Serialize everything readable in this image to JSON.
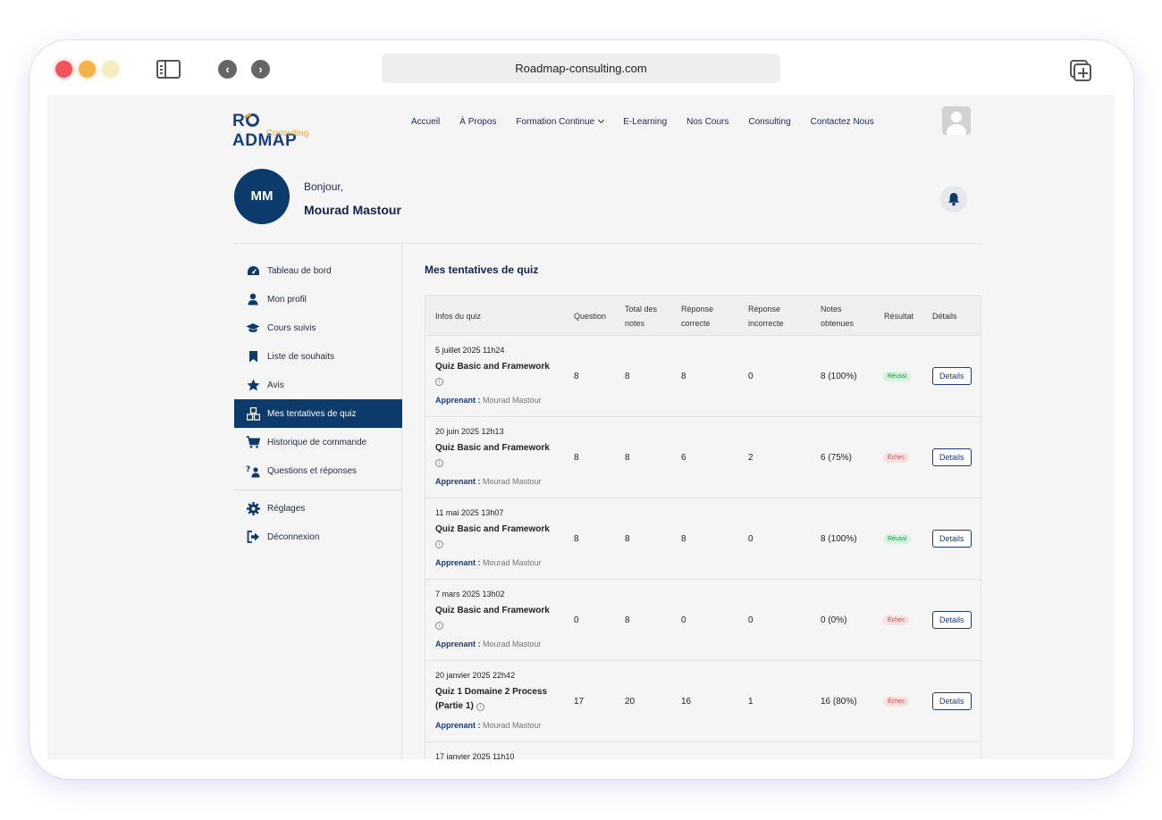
{
  "browser": {
    "url": "Roadmap-consulting.com"
  },
  "site": {
    "logo_main": "ROADMAP",
    "logo_sub": "Consulting",
    "nav": [
      "Accueil",
      "À Propos",
      "Formation Continue",
      "E-Learning",
      "Nos Cours",
      "Consulting",
      "Contactez Nous"
    ]
  },
  "profile": {
    "initials": "MM",
    "greeting": "Bonjour,",
    "name": "Mourad Mastour"
  },
  "menu": {
    "items": [
      {
        "label": "Tableau de bord",
        "icon": "dashboard-icon"
      },
      {
        "label": "Mon profil",
        "icon": "user-icon"
      },
      {
        "label": "Cours suivis",
        "icon": "graduation-cap-icon"
      },
      {
        "label": "Liste de souhaits",
        "icon": "bookmark-icon"
      },
      {
        "label": "Avis",
        "icon": "star-icon"
      },
      {
        "label": "Mes tentatives de quiz",
        "icon": "quiz-blocks-icon",
        "active": true
      },
      {
        "label": "Historique de commande",
        "icon": "cart-icon"
      },
      {
        "label": "Questions et réponses",
        "icon": "question-answer-icon"
      }
    ],
    "secondary": [
      {
        "label": "Réglages",
        "icon": "gear-icon"
      },
      {
        "label": "Déconnexion",
        "icon": "logout-icon"
      }
    ]
  },
  "quiz": {
    "title": "Mes tentatives de quiz",
    "columns": {
      "info": "Infos du quiz",
      "question": "Question",
      "total_line1": "Total des",
      "total_line2": "notes",
      "correct_line1": "Réponse",
      "correct_line2": "correcte",
      "incorrect_line1": "Réponse",
      "incorrect_line2": "incorrecte",
      "obtained_line1": "Notes",
      "obtained_line2": "obtenues",
      "result": "Résultat",
      "details": "Détails"
    },
    "learner_label": "Apprenant :",
    "details_label": "Details",
    "rows": [
      {
        "date": "5 juillet 2025 11h24",
        "name": "Quiz Basic and Framework",
        "learner": "Mourad Mastour",
        "question": "8",
        "total": "8",
        "correct": "8",
        "incorrect": "0",
        "obtained": "8 (100%)",
        "result": "Réussi",
        "status": "ok"
      },
      {
        "date": "20 juin 2025 12h13",
        "name": "Quiz Basic and Framework",
        "learner": "Mourad Mastour",
        "question": "8",
        "total": "8",
        "correct": "6",
        "incorrect": "2",
        "obtained": "6 (75%)",
        "result": "Échec",
        "status": "fail"
      },
      {
        "date": "11 mai 2025 13h07",
        "name": "Quiz Basic and Framework",
        "learner": "Mourad Mastour",
        "question": "8",
        "total": "8",
        "correct": "8",
        "incorrect": "0",
        "obtained": "8 (100%)",
        "result": "Réussi",
        "status": "ok"
      },
      {
        "date": "7 mars 2025 13h02",
        "name": "Quiz Basic and Framework",
        "learner": "Mourad Mastour",
        "question": "0",
        "total": "8",
        "correct": "0",
        "incorrect": "0",
        "obtained": "0 (0%)",
        "result": "Échec",
        "status": "fail"
      },
      {
        "date": "20 janvier 2025 22h42",
        "name": "Quiz 1 Domaine 2 Process (Partie 1)",
        "learner": "Mourad Mastour",
        "question": "17",
        "total": "20",
        "correct": "16",
        "incorrect": "1",
        "obtained": "16 (80%)",
        "result": "Échec",
        "status": "fail"
      },
      {
        "date": "17 janvier 2025 11h10"
      }
    ]
  }
}
